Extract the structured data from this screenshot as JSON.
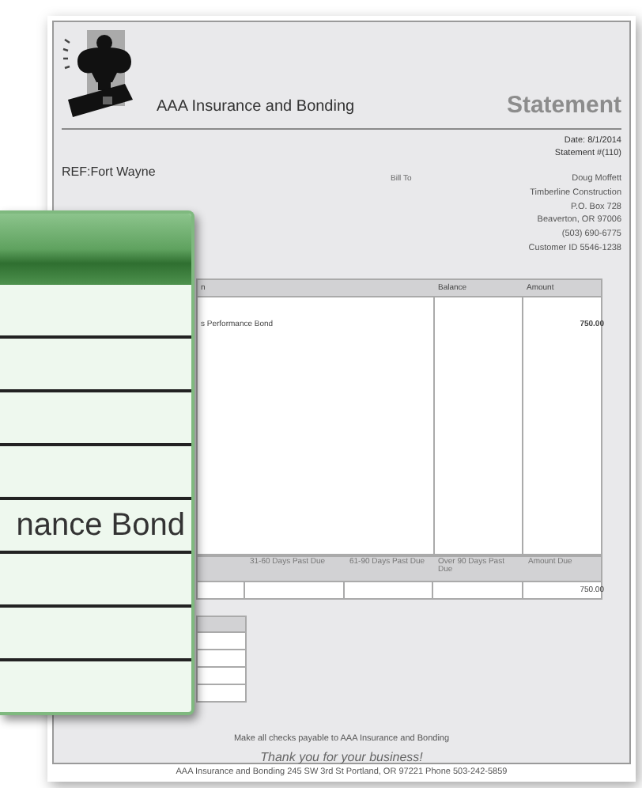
{
  "document": {
    "company": "AAA Insurance and Bonding",
    "title": "Statement",
    "date": "Date: 8/1/2014",
    "statement_number": "Statement #(110)",
    "reference": "REF:Fort Wayne",
    "bill_to_label": "Bill To",
    "bill_to": [
      "Doug Moffett",
      "Timberline Construction",
      "P.O. Box 728",
      "Beaverton, OR 97006",
      "(503) 690-6775",
      "Customer ID 5546-1238"
    ],
    "items_table": {
      "columns": [
        "n",
        "Balance",
        "Amount"
      ],
      "rows": [
        [
          "s Performance Bond",
          null,
          "750.00"
        ]
      ]
    },
    "aging_table": {
      "columns": [
        null,
        "31-60 Days Past Due",
        "61-90 Days Past Due",
        "Over 90 Days Past Due",
        "Amount Due"
      ],
      "rows": [
        [
          null,
          null,
          null,
          null,
          "750.00"
        ]
      ]
    },
    "payable_note": "Make all checks payable to AAA Insurance and Bonding",
    "thanks": "Thank you for your business!",
    "footer": "AAA Insurance and Bonding  245 SW 3rd St Portland, OR 97221  Phone 503-242-5859"
  },
  "magnifier": {
    "rows": [
      {
        "kind": "blank"
      },
      {
        "kind": "blank"
      },
      {
        "kind": "blank"
      },
      {
        "kind": "blank"
      },
      {
        "kind": "text",
        "text": "nance Bond"
      },
      {
        "kind": "blank"
      },
      {
        "kind": "blank"
      },
      {
        "kind": "blank"
      }
    ]
  }
}
